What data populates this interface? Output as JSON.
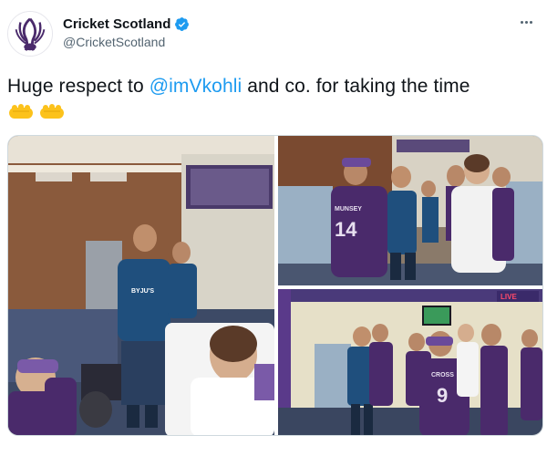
{
  "account": {
    "display_name": "Cricket Scotland",
    "handle": "@CricketScotland",
    "verified": true,
    "avatar_icon": "cricket-scotland-thistle-logo"
  },
  "tweet": {
    "text_before": "Huge respect to ",
    "mention": "@imVkohli",
    "text_after": " and co. for taking the time",
    "emojis": [
      "hand-emoji",
      "hand-emoji"
    ],
    "more_icon": "more-options-icon"
  },
  "photos": {
    "photo_1": {
      "jersey_text": "BYJU'S"
    },
    "photo_2": {
      "jersey_name": "MUNSEY",
      "jersey_number": "14"
    },
    "photo_3": {
      "jersey_name": "CROSS",
      "jersey_number": "9",
      "screen_logo": "LIVE"
    }
  },
  "colors": {
    "link": "#1d9bf0",
    "scotland_kit": "#4a2a6b",
    "india_kit": "#1f4f7d"
  }
}
